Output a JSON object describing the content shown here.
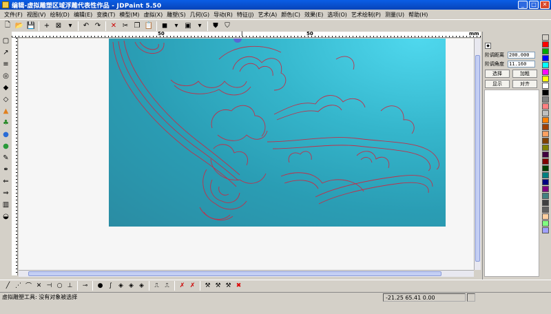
{
  "window": {
    "title": "编辑-虚拟雕塑区域浮雕代表性作品 - JDPaint 5.50",
    "controls": [
      "minimize",
      "maximize",
      "close"
    ]
  },
  "menu": [
    "文件(F)",
    "视图(V)",
    "绘制(D)",
    "编辑(E)",
    "变换(T)",
    "模型(M)",
    "虚拟(X)",
    "雕塑(S)",
    "几何(G)",
    "导动(R)",
    "特征(J)",
    "艺术(A)",
    "颜色(C)",
    "效果(E)",
    "选项(O)",
    "艺术绘制(P)",
    "测量(U)",
    "帮助(H)"
  ],
  "top_toolbar_icons": [
    "new-icon",
    "open-icon",
    "save-icon",
    "sep",
    "add-icon",
    "box-icon",
    "dropdown-icon",
    "sep",
    "undo-icon",
    "redo-icon",
    "sep",
    "delete-icon",
    "cut-icon",
    "copy-icon",
    "paste-icon",
    "sep",
    "cube-icon",
    "dropdown-icon",
    "view-icon",
    "dropdown-icon",
    "sep",
    "shield-icon",
    "shield-alt-icon"
  ],
  "ruler": {
    "labels": [
      "50",
      "|",
      "50",
      "mm"
    ]
  },
  "left_toolbar_icons": [
    "select-rect-icon",
    "pointer-icon",
    "layer-icon",
    "target-icon",
    "sculpt-icon",
    "shape-icon",
    "color-icon",
    "tree-icon",
    "bulb-blue-icon",
    "bulb-green-icon",
    "brush-icon",
    "link-icon",
    "arrow-left-icon",
    "arrow-right-icon",
    "cube-blue-icon",
    "grey-tool-icon"
  ],
  "panel": {
    "distance_label": "阶调距离",
    "distance_value": "200.000",
    "angle_label": "阶调角度",
    "angle_value": "11.160",
    "buttons": [
      "选择",
      "加粗",
      "显示",
      "对齐"
    ]
  },
  "palette_colors": [
    "#d4d0c8",
    "#ff0000",
    "#00aa00",
    "#0000ff",
    "#00ffff",
    "#ff00ff",
    "#ffff00",
    "#ffffff",
    "#000000",
    "#808080",
    "#ff8080",
    "#c0c0c0",
    "#ff8000",
    "#a04000",
    "#ffa060",
    "#804000",
    "#808000",
    "#400040",
    "#800000",
    "#004000",
    "#008080",
    "#000080",
    "#800080",
    "#408080",
    "#404040",
    "#606060",
    "#ffd0a0",
    "#80ff80",
    "#a0a0ff"
  ],
  "bottom_toolbar_icons": [
    "line-icon",
    "polyline-icon",
    "arc-icon",
    "cross-icon",
    "trim-icon",
    "circle-icon",
    "perpendicular-icon",
    "sep",
    "tangent-icon",
    "sep",
    "dot-icon",
    "curve-icon",
    "diamond-icon",
    "diamond-icon",
    "diamond-icon",
    "sep",
    "stamp-icon",
    "stamp-icon",
    "sep",
    "node-x-icon",
    "node-x-icon",
    "sep",
    "tool-icon",
    "tool-icon",
    "tool-icon",
    "delete-red-icon"
  ],
  "status": {
    "message": "虚拟雕塑工具: 没有对象被选择",
    "coords": "-21.25 65.41 0.00"
  }
}
